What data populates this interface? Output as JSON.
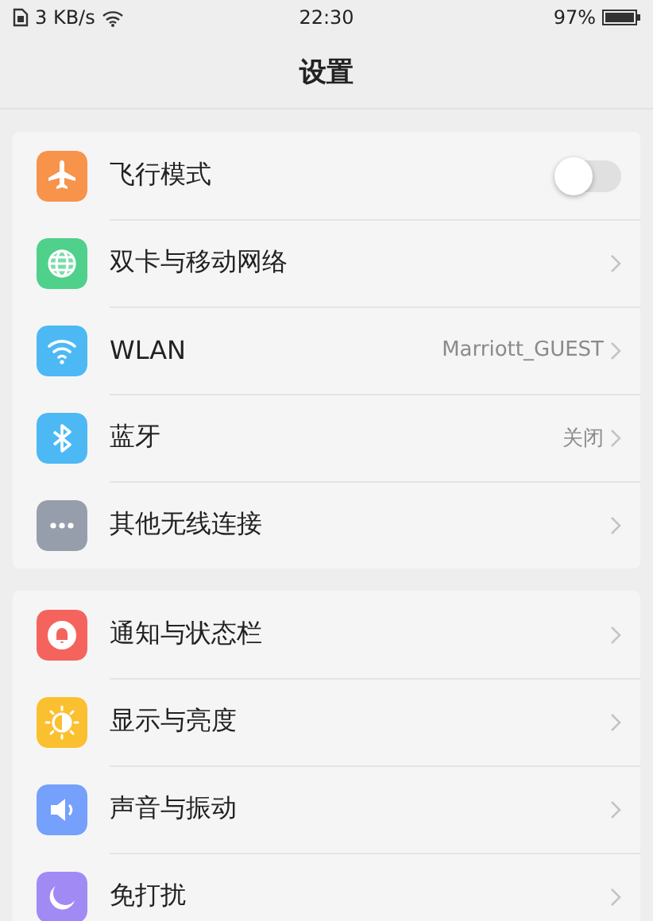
{
  "status_bar": {
    "speed": "3 KB/s",
    "time": "22:30",
    "battery": "97%"
  },
  "title": "设置",
  "groups": [
    {
      "items": [
        {
          "kind": "toggle",
          "label": "飞行模式",
          "color": "#f7934a",
          "on": false
        },
        {
          "kind": "link",
          "label": "双卡与移动网络",
          "color": "#4fd18b"
        },
        {
          "kind": "link",
          "label": "WLAN",
          "color": "#4cb9f5",
          "value": "Marriott_GUEST"
        },
        {
          "kind": "link",
          "label": "蓝牙",
          "color": "#4cb9f5",
          "value": "关闭"
        },
        {
          "kind": "link",
          "label": "其他无线连接",
          "color": "#979eab"
        }
      ]
    },
    {
      "items": [
        {
          "kind": "link",
          "label": "通知与状态栏",
          "color": "#f4645d"
        },
        {
          "kind": "link",
          "label": "显示与亮度",
          "color": "#fbc02f"
        },
        {
          "kind": "link",
          "label": "声音与振动",
          "color": "#75a0fb"
        },
        {
          "kind": "link",
          "label": "免打扰",
          "color": "#a28af5"
        }
      ]
    }
  ]
}
